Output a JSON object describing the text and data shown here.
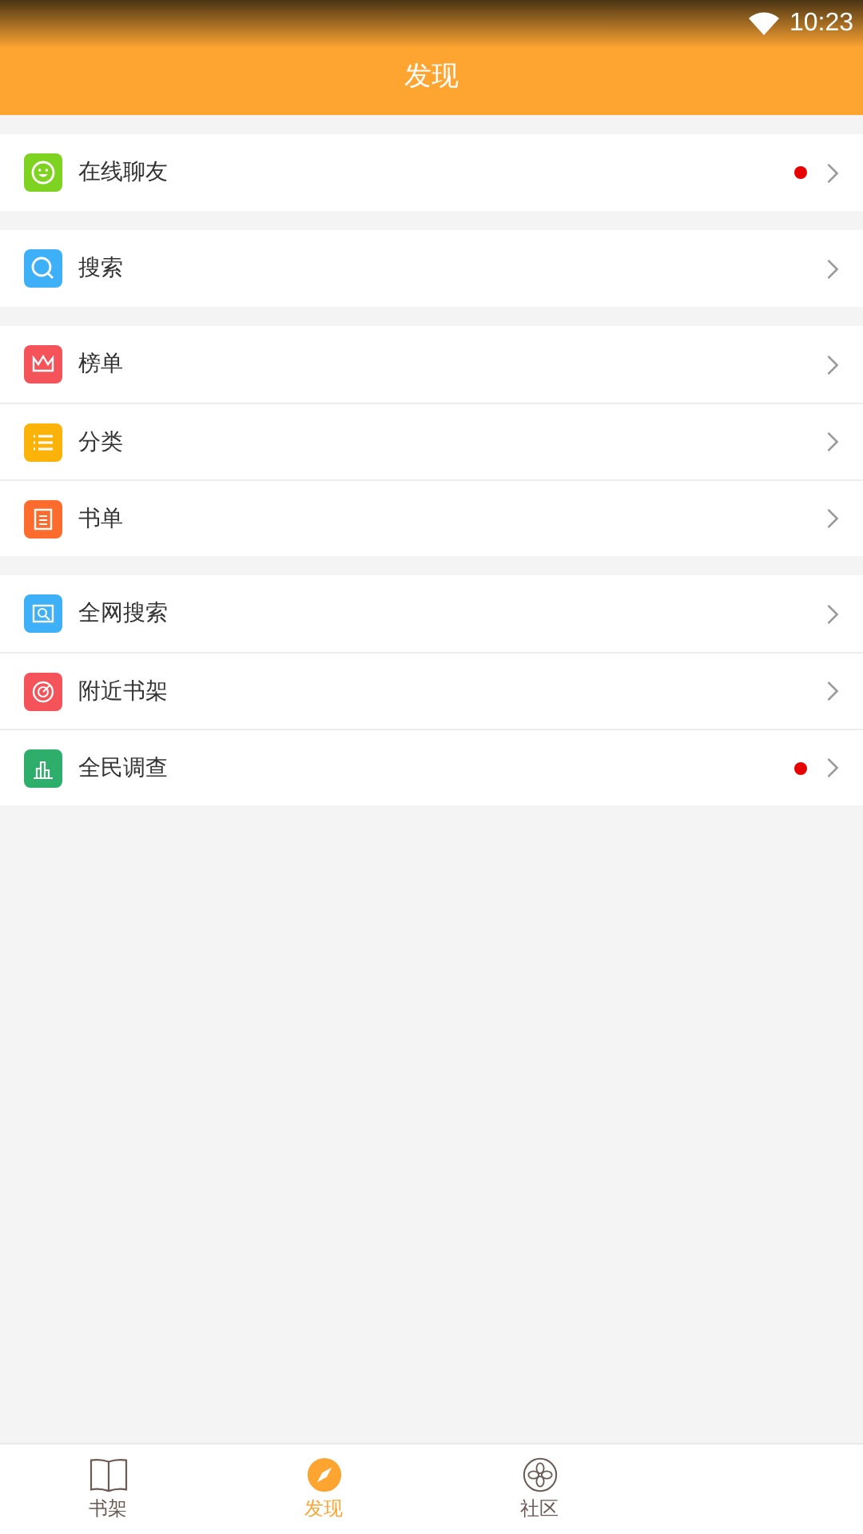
{
  "status_bar": {
    "time": "10:23"
  },
  "header": {
    "title": "发现"
  },
  "groups": [
    {
      "items": [
        {
          "label": "在线聊友",
          "color": "#7ed321",
          "dot": true
        }
      ]
    },
    {
      "items": [
        {
          "label": "搜索",
          "color": "#3eb0f7",
          "dot": false
        }
      ]
    },
    {
      "items": [
        {
          "label": "榜单",
          "color": "#f5535a",
          "dot": false
        },
        {
          "label": "分类",
          "color": "#fbb309",
          "dot": false
        },
        {
          "label": "书单",
          "color": "#fd6c2d",
          "dot": false
        }
      ]
    },
    {
      "items": [
        {
          "label": "全网搜索",
          "color": "#3eb0f7",
          "dot": false
        },
        {
          "label": "附近书架",
          "color": "#f5535a",
          "dot": false
        },
        {
          "label": "全民调查",
          "color": "#2dae6a",
          "dot": true
        }
      ]
    }
  ],
  "tabs": [
    {
      "label": "书架",
      "selected": false
    },
    {
      "label": "发现",
      "selected": true
    },
    {
      "label": "社区",
      "selected": false
    }
  ]
}
